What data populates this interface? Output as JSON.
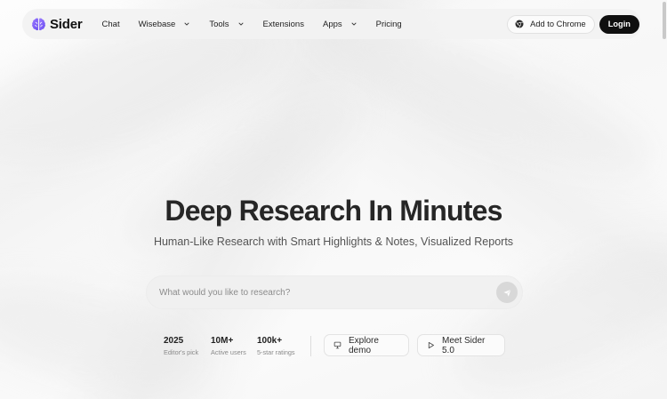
{
  "brand": {
    "name": "Sider",
    "logo_icon": "brain-icon",
    "accent": "#7b5cff"
  },
  "nav": {
    "items": [
      {
        "label": "Chat",
        "has_dropdown": false
      },
      {
        "label": "Wisebase",
        "has_dropdown": true
      },
      {
        "label": "Tools",
        "has_dropdown": true
      },
      {
        "label": "Extensions",
        "has_dropdown": false
      },
      {
        "label": "Apps",
        "has_dropdown": true
      },
      {
        "label": "Pricing",
        "has_dropdown": false
      }
    ],
    "add_to_chrome": "Add to Chrome",
    "login": "Login"
  },
  "hero": {
    "title": "Deep Research In Minutes",
    "subtitle": "Human-Like Research with Smart Highlights & Notes, Visualized Reports"
  },
  "search": {
    "placeholder": "What would you like to research?",
    "value": ""
  },
  "stats": [
    {
      "value": "2025",
      "label": "Editor's pick"
    },
    {
      "value": "10M+",
      "label": "Active users"
    },
    {
      "value": "100k+",
      "label": "5-star ratings"
    }
  ],
  "actions": {
    "explore_demo": "Explore demo",
    "meet_sider": "Meet Sider 5.0"
  }
}
